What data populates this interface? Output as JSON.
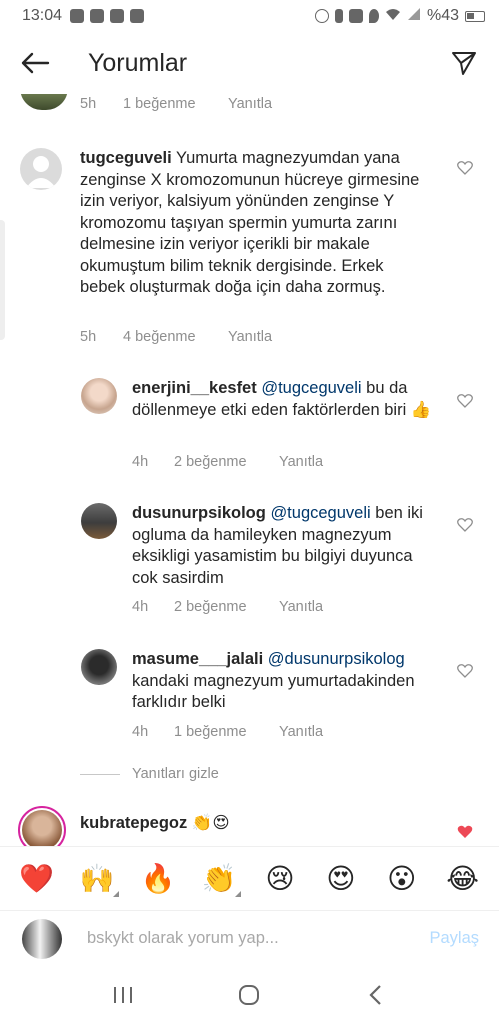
{
  "status_bar": {
    "time": "13:04",
    "battery": "%43"
  },
  "header": {
    "title": "Yorumlar"
  },
  "top_partial": {
    "time": "5h",
    "likes": "1 beğenme",
    "reply": "Yanıtla"
  },
  "comments": [
    {
      "username": "tugceguveli",
      "text": "Yumurta magnezyumdan yana zenginse X kromozomunun hücreye girmesine izin veriyor, kalsiyum yönünden zenginse Y kromozomu taşıyan spermin yumurta zarını delmesine izin veriyor içerikli bir makale okumuştum bilim teknik dergisinde. Erkek bebek oluşturmak doğa için daha zormuş.",
      "time": "5h",
      "likes": "4 beğenme",
      "reply": "Yanıtla"
    },
    {
      "username": "enerjini__kesfet",
      "mention": "@tugceguveli",
      "text": "bu da döllenmeye etki eden faktörlerden biri 👍",
      "time": "4h",
      "likes": "2 beğenme",
      "reply": "Yanıtla"
    },
    {
      "username": "dusunurpsikolog",
      "mention": "@tugceguveli",
      "text": "ben iki ogluma da hamileyken magnezyum eksikligi yasamistim bu bilgiyi duyunca cok sasirdim",
      "time": "4h",
      "likes": "2 beğenme",
      "reply": "Yanıtla"
    },
    {
      "username": "masume___jalali",
      "mention": "@dusunurpsikolog",
      "text": "kandaki magnezyum yumurtadakinden farklıdır  belki",
      "time": "4h",
      "likes": "1 beğenme",
      "reply": "Yanıtla"
    },
    {
      "username": "kubratepegoz",
      "text": "👏😍"
    }
  ],
  "hide_replies": "Yanıtları gizle",
  "emojis": [
    "❤️",
    "🙌",
    "🔥",
    "👏",
    "😢",
    "😍",
    "😮",
    "😂"
  ],
  "input": {
    "placeholder": "bskykt olarak yorum yap...",
    "post_label": "Paylaş"
  },
  "colors": {
    "mention": "#00376b",
    "meta_gray": "#8e8e8e",
    "post_button": "#b3dbff",
    "liked_heart": "#ed4956"
  },
  "icons": {
    "back": "arrow-left-icon",
    "send": "paper-plane-icon",
    "like": "heart-outline-icon",
    "liked": "heart-filled-icon"
  }
}
